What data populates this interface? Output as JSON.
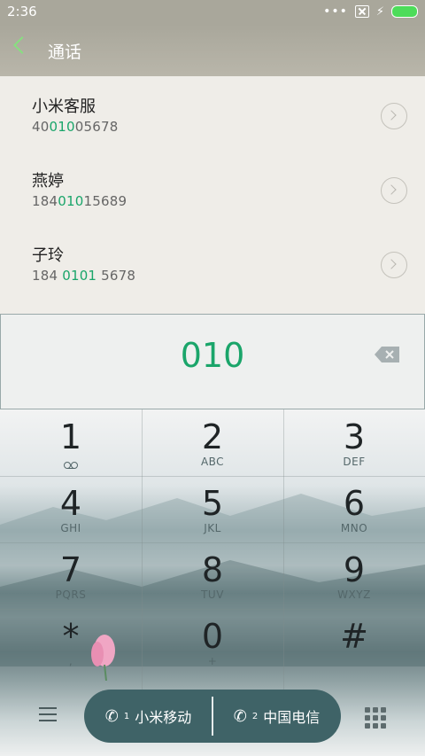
{
  "status": {
    "time": "2:36",
    "dots": "•••",
    "bolt": "⚡"
  },
  "topbar": {
    "title": "通话"
  },
  "results": [
    {
      "name": "小米客服",
      "num_pre": "40",
      "num_hl": "010",
      "num_post": "05678"
    },
    {
      "name": "燕婷",
      "num_pre": "184",
      "num_hl": "010",
      "num_post": "15689"
    },
    {
      "name": "子玲",
      "num_pre": "184 ",
      "num_hl": "0101",
      "num_post": " 5678"
    }
  ],
  "display": {
    "digits": "010"
  },
  "keypad": [
    {
      "digit": "1",
      "letters": ""
    },
    {
      "digit": "2",
      "letters": "ABC"
    },
    {
      "digit": "3",
      "letters": "DEF"
    },
    {
      "digit": "4",
      "letters": "GHI"
    },
    {
      "digit": "5",
      "letters": "JKL"
    },
    {
      "digit": "6",
      "letters": "MNO"
    },
    {
      "digit": "7",
      "letters": "PQRS"
    },
    {
      "digit": "8",
      "letters": "TUV"
    },
    {
      "digit": "9",
      "letters": "WXYZ"
    },
    {
      "digit": "*",
      "letters": ","
    },
    {
      "digit": "0",
      "letters": "+"
    },
    {
      "digit": "#",
      "letters": ""
    }
  ],
  "call": {
    "sim1_label": "小米移动",
    "sim1_index": "1",
    "sim2_label": "中国电信",
    "sim2_index": "2"
  },
  "colors": {
    "accent": "#1aa56a",
    "call_bar": "#3f6367",
    "battery": "#4ddc5a"
  }
}
